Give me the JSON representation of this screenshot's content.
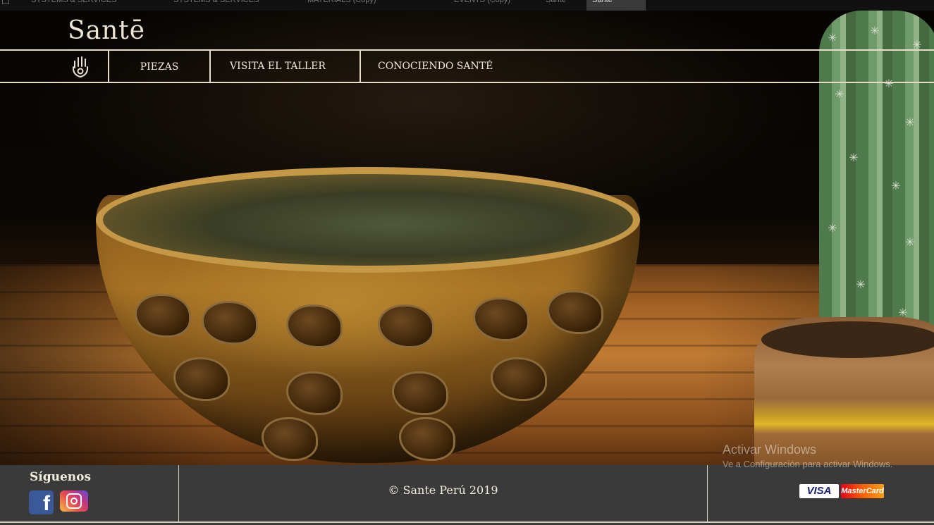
{
  "browser": {
    "tabs": [
      {
        "label": "SYSTEMS & SERVICES",
        "active": false
      },
      {
        "label": "SYSTEMS & SERVICES",
        "active": false
      },
      {
        "label": "MATERIALS (Copy)",
        "active": false
      },
      {
        "label": "EVENTS (Copy)",
        "active": false
      },
      {
        "label": "Sante",
        "active": false
      },
      {
        "label": "Sante",
        "active": true
      }
    ]
  },
  "site": {
    "logo": "Santē"
  },
  "nav": {
    "icon": "hamsa-hand-icon",
    "items": [
      {
        "label": "PIEZAS"
      },
      {
        "label": "VISITA EL TALLER"
      },
      {
        "label": "CONOCIENDO SANTÉ"
      }
    ]
  },
  "footer": {
    "follow_label": "Síguenos",
    "social": [
      {
        "name": "facebook-icon",
        "glyph": "f"
      },
      {
        "name": "instagram-icon"
      }
    ],
    "copyright": "© Sante Perú 2019",
    "payments": [
      {
        "name": "visa-logo",
        "label": "VISA"
      },
      {
        "name": "mastercard-logo",
        "label": "MasterCard"
      }
    ]
  },
  "watermark": {
    "title": "Activar Windows",
    "subtitle": "Ve a Configuración para activar Windows."
  },
  "colors": {
    "footer_bg": "#3a3a3a",
    "line": "#e6ddc8",
    "text": "#f2ead9"
  }
}
